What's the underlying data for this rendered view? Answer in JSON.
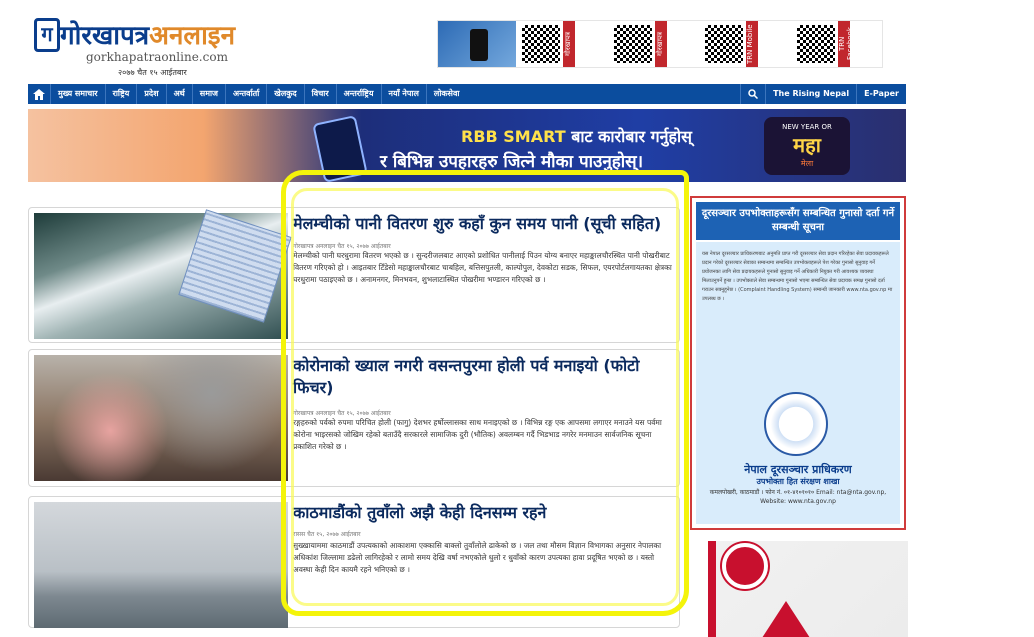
{
  "header": {
    "logo_mark": "ग",
    "logo_title": "गोरखापत्र",
    "logo_online": "अनलाइन",
    "site": "gorkhapatraonline.com",
    "date": "२०७७ चैत १५ आईतबार"
  },
  "top_ads": [
    "गोरखापत्र",
    "गोरखापत्र",
    "TRN Mobile",
    "TRN Facebook"
  ],
  "nav": {
    "items": [
      "मुख्य समाचार",
      "राष्ट्रिय",
      "प्रदेश",
      "अर्थ",
      "समाज",
      "अन्तर्वार्ता",
      "खेलकुद",
      "विचार",
      "अन्तर्राष्ट्रिय",
      "नयाँ नेपाल",
      "लोकसेवा"
    ],
    "search_icon": "search-icon",
    "right": [
      "The Rising Nepal",
      "E-Paper"
    ]
  },
  "banner": {
    "line1_brand": "RBB SMART",
    "line1_rest": " बाट कारोबार गर्नुहोस्",
    "line2": "र बिभिन्न उपहारहरु जित्ने मौका पाउनुहोस्।",
    "badge_top": "NEW YEAR OR",
    "badge_main": "महा",
    "badge_sub": "मेला"
  },
  "articles": [
    {
      "title": "मेलम्चीको पानी वितरण शुरु कहाँ कुन समय पानी (सूची सहित)",
      "meta": "गोरखापत्र अनलाइन    चैत १५, २०७७ आईतबार",
      "body": "मेलम्चीको पानी घरधुरामा वितरण भएको छ । सुन्दरीजलबाट आएको प्रशोधित पानीलाई पिउन योग्य बनाएर महाङ्कालचौरस्थित पानी पोखरीबाट वितरण गरिएको हो । आइतबार टिँडेसो महाङ्कालचौरबाट चाबहिल, बत्तिसपुतली, काल्पोपुल, देवकोटा सडक, सिफल, एयरपोर्टलगायतका क्षेत्रका घरधुरामा पठाइएको छ । अनामनगर, मिनभवन, शुभलाटास्थित पोखरीमा भण्डारन गरिएको छ ।"
    },
    {
      "title": "कोरोनाको ख्याल नगरी वसन्तपुरमा होली पर्व मनाइयो (फोटो फिचर)",
      "meta": "गोरखापत्र अनलाइन    चैत १५, २०७७ आईतबार",
      "body": "रङ्गहरुको पर्वको रुपमा परिचित होली (फागु) देशभर हर्षोल्लासका साथ मनाइएको छ । विभिन्न रङ्ग एक आपसमा लगाएर मनाउने यस पर्वमा कोरोना भाइरसको जोखिम रहेको बताउँदै सरकारले सामाजिक दुरी (भौतिक) अवलम्बन गर्दै भिडभाड नगरेर मनमाउन सार्वजनिक सूचना प्रकाशित गरेको छ ।"
    },
    {
      "title": "काठमाडौंको तुवाँलो अझै केही दिनसम्म रहने",
      "meta": "रासस    चैत १५, २०७७ आईतबार",
      "body": "सुख्खायाममा काठमाडौं उपत्यकाको आकाशमा एक्कासि बाक्लो तुवाँलोले ढाकेको छ । जल तथा मौसम विज्ञान विभागका अनुसार नेपालका अधिकांश जिल्लामा डढेलो लागिरहेको र लामो समय देखि वर्षा नभएकोले धुलो र धुवाँको कारण उपत्यका हावा प्रदूषित भएको छ । यस्तो अवस्था केही दिन कायमै रहने भनिएको छ ।"
    }
  ],
  "notice": {
    "header": "दूरसञ्चार उपभोक्ताहरूसँग सम्बन्धित गुनासो दर्ता गर्ने सम्बन्धी सूचना",
    "text": "यस नेपाल दूरसञ्चार प्राधिकरणबाट अनुमति प्राप्त गरी दूरसञ्चार सेवा प्रदान गरिरहेका सेवा प्रदायकहरूले प्रदान गरेको दूरसञ्चार सेवाका सम्बन्धमा सम्बन्धित उपभोक्ताहरूले पेश गरेका गुनासो सुनुवाइ गर्ने प्रयोजनका लागि सेवा प्रदायकहरूले गुनासो सुनुवाइ गर्ने अधिकारी नियुक्त गरी आवश्यक व्यवस्था मिलाउनुपर्ने हुन्छ । उपभोक्ताले सेवा सम्बन्धमा गुनासो भएमा सम्बन्धित सेवा प्रदायक समक्ष गुनासो दर्ता गराउन सक्नुहुनेछ । (Complaint Handling System) सम्बन्धी जानकारी www.nta.gov.np मा उपलब्ध छ ।",
    "org": "नेपाल दूरसञ्चार प्राधिकरण",
    "sub": "उपभोक्ता हित संरक्षण शाखा",
    "small": "कमलपोखरी, काठमाडौं । फोन नं. ०१-४१०१०१० Email: nta@nta.gov.np, Website: www.nta.gov.np"
  },
  "colors": {
    "nav": "#0b4d9e",
    "highlight": "#f4f40a",
    "title": "#0b2a5e"
  }
}
